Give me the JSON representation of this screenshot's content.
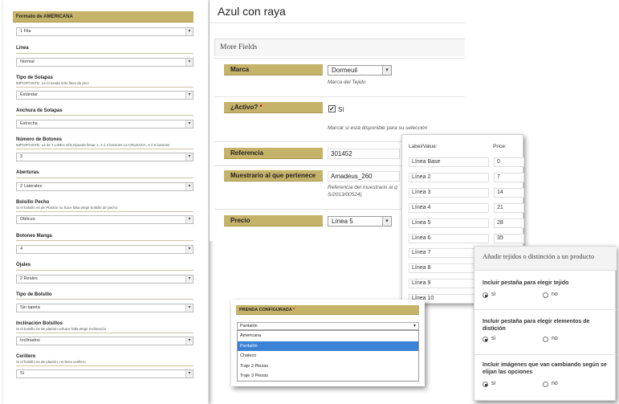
{
  "left_form": {
    "header": "Formato de AMERICANA",
    "fields": [
      {
        "label": "",
        "help": "",
        "value": "1 Fila"
      },
      {
        "label": "Linea",
        "help": "",
        "value": "Normal"
      },
      {
        "label": "Tipo de Solapas",
        "help": "IMPORTANTE: La Cruzada sólo lleva de pico",
        "value": "Estándar"
      },
      {
        "label": "Anchura de Solapas",
        "help": "",
        "value": "Estrecha"
      },
      {
        "label": "Número de Botones",
        "help": "IMPORTANTE: La de 1 LINEA SÓLOpuede llevar 1, 2 ó 3 botones La CRUZADA, 4 ó 6 botones",
        "value": "3"
      },
      {
        "label": "Aberturas",
        "help": "",
        "value": "2 Laterales"
      },
      {
        "label": "Bolsillo Pecho",
        "help": "Si el bolsillo es de Plastón no hace falta elegir bolsillo de pecho",
        "value": "Oblicuo"
      },
      {
        "label": "Botones Manga",
        "help": "",
        "value": "4"
      },
      {
        "label": "Ojales",
        "help": "",
        "value": "2 Reales"
      },
      {
        "label": "Tipo de Bolsillo",
        "help": "",
        "value": "Sin tapeta"
      },
      {
        "label": "Inclinación Bolsillos",
        "help": "Si el bolsillo es de plastón nohace falta elegir inclinación",
        "value": "Inclinados"
      },
      {
        "label": "Cerillero",
        "help": "Si el bolsillo es de plastón, no lleva cerillero",
        "value": "Si"
      }
    ]
  },
  "main": {
    "title": "Azul con raya",
    "section_title": "More Fields",
    "marca": {
      "label": "Marca",
      "value": "Dormeuil",
      "help": "Marca del Tejido"
    },
    "activo": {
      "label": "¿Activo?",
      "required": "*",
      "checkbox_label": "Sí",
      "help": "Marcar si está disponible para su selección"
    },
    "referencia": {
      "label": "Referencia",
      "value": "301452"
    },
    "muestrario": {
      "label": "Muestrario al que pertenece",
      "value": "Amadeus_260",
      "help_line1": "Referencia del muestrario al q",
      "help_line2": "S/2013/00524)"
    },
    "precio": {
      "label": "Precio",
      "value": "Línea 5"
    }
  },
  "price_table": {
    "col_label": "Label/Value:",
    "col_price": "Price:",
    "rows": [
      {
        "label": "Línea Base",
        "price": "0"
      },
      {
        "label": "Línea 2",
        "price": "7"
      },
      {
        "label": "Línea 3",
        "price": "14"
      },
      {
        "label": "Línea 4",
        "price": "21"
      },
      {
        "label": "Línea 5",
        "price": "28"
      },
      {
        "label": "Línea 6",
        "price": "35"
      },
      {
        "label": "Línea 7",
        "price": ""
      },
      {
        "label": "Línea 8",
        "price": ""
      },
      {
        "label": "Línea 9",
        "price": ""
      },
      {
        "label": "Línea 10",
        "price": ""
      }
    ]
  },
  "prenda": {
    "header": "PRENDA CONFIGURADA",
    "required": "*",
    "selected": "Pantalón",
    "options": [
      "Americana",
      "Pantalón",
      "Chaleco",
      "Traje 2 Piezas",
      "Traje 3 Piezas"
    ],
    "highlighted_index": 1
  },
  "tejidos": {
    "title": "Añadir tejidos o distinción a un producto",
    "questions": [
      {
        "text": "Incluir pestaña para elegir tejido",
        "yes": "si",
        "no": "no",
        "selected": "si"
      },
      {
        "text": "Incluir pestaña para elegir elementos de distición",
        "yes": "si",
        "no": "no",
        "selected": "si"
      },
      {
        "text": "Incluir imágenes que van cambiando según se elijan las opciones",
        "yes": "si",
        "no": "no",
        "selected": "si"
      }
    ]
  },
  "colors": {
    "header_gold": "#c6b36a",
    "highlight_blue": "#3b82d6"
  }
}
